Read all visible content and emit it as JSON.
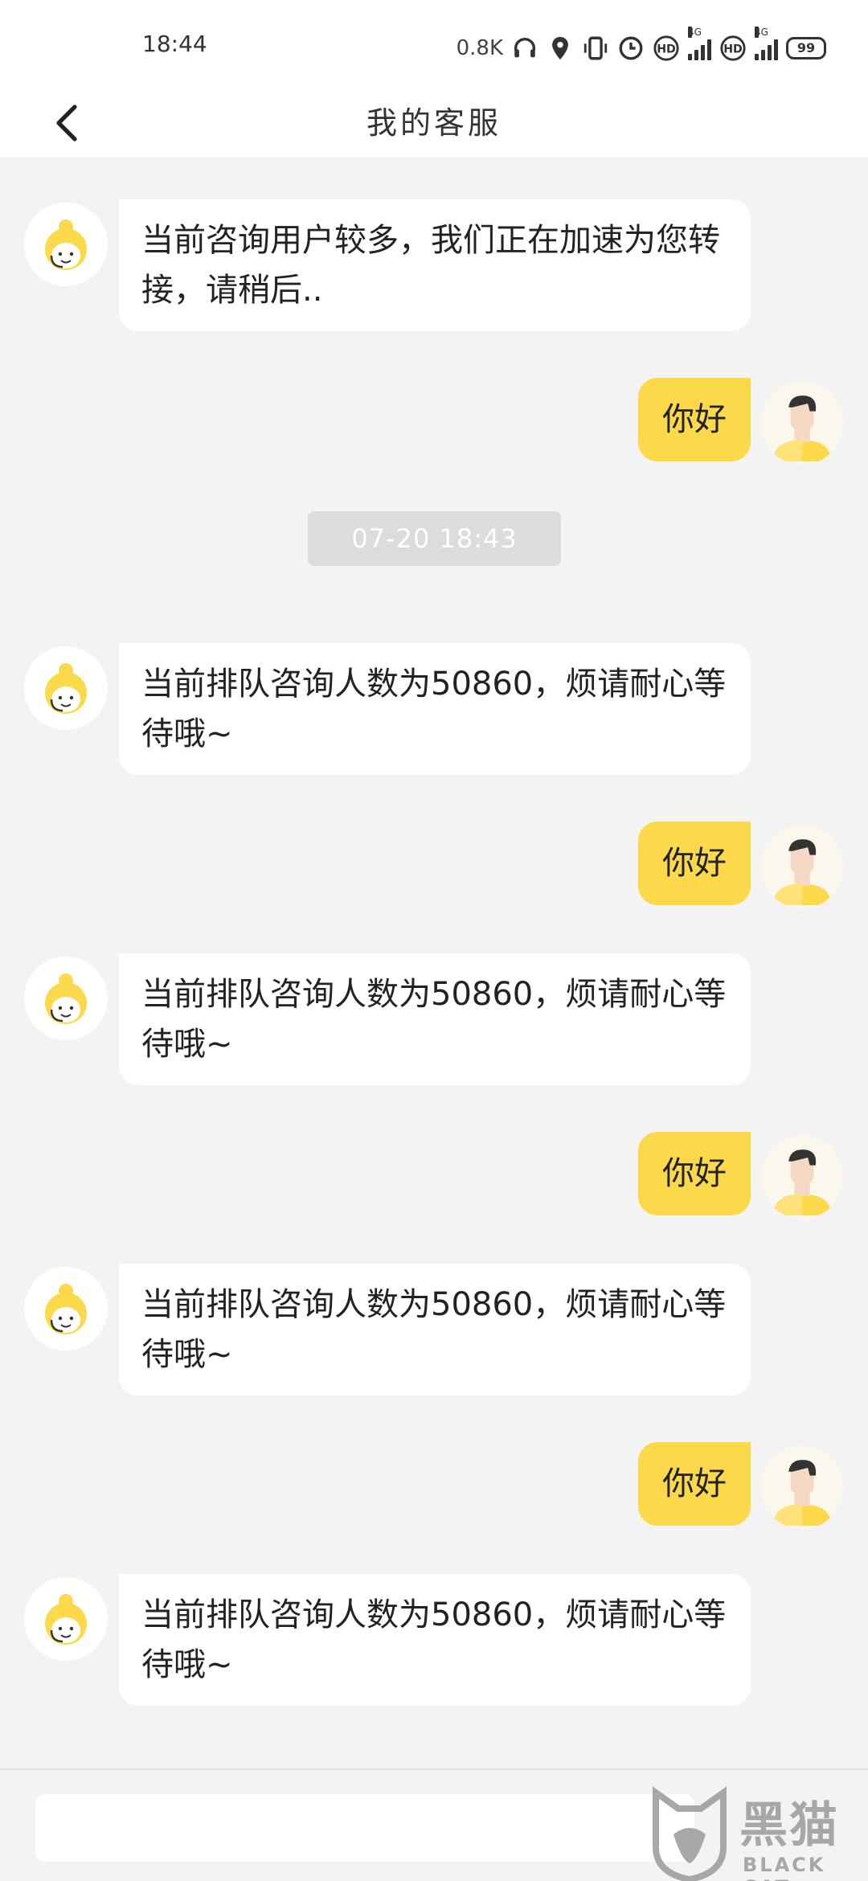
{
  "status_bar": {
    "time": "18:44",
    "net_speed": "0.8K",
    "signal_tag_1": "4G",
    "signal_tag_2": "4G",
    "hd_1": "HD",
    "hd_2": "HD",
    "battery": "99"
  },
  "nav": {
    "title": "我的客服"
  },
  "messages": [
    {
      "from": "agent",
      "text": "当前咨询用户较多，我们正在加速为您转接，请稍后.."
    },
    {
      "from": "user",
      "text": "你好"
    },
    {
      "from": "time",
      "text": "07-20 18:43"
    },
    {
      "from": "agent",
      "text": "当前排队咨询人数为50860，烦请耐心等待哦~"
    },
    {
      "from": "user",
      "text": "你好"
    },
    {
      "from": "agent",
      "text": "当前排队咨询人数为50860，烦请耐心等待哦~"
    },
    {
      "from": "user",
      "text": "你好"
    },
    {
      "from": "agent",
      "text": "当前排队咨询人数为50860，烦请耐心等待哦~"
    },
    {
      "from": "user",
      "text": "你好"
    },
    {
      "from": "agent",
      "text": "当前排队咨询人数为50860，烦请耐心等待哦~"
    }
  ],
  "input": {
    "value": "",
    "placeholder": ""
  },
  "watermark": {
    "text": "黑猫",
    "sub": "BLACK CAT"
  },
  "colors": {
    "accent": "#fcd94b",
    "background": "#f3f3f3",
    "bubble_agent": "#ffffff",
    "time_pill": "#dcdcdc"
  },
  "icons": {
    "back": "chevron-left-icon",
    "agent_avatar": "agent-avatar-icon",
    "user_avatar": "user-avatar-icon"
  }
}
